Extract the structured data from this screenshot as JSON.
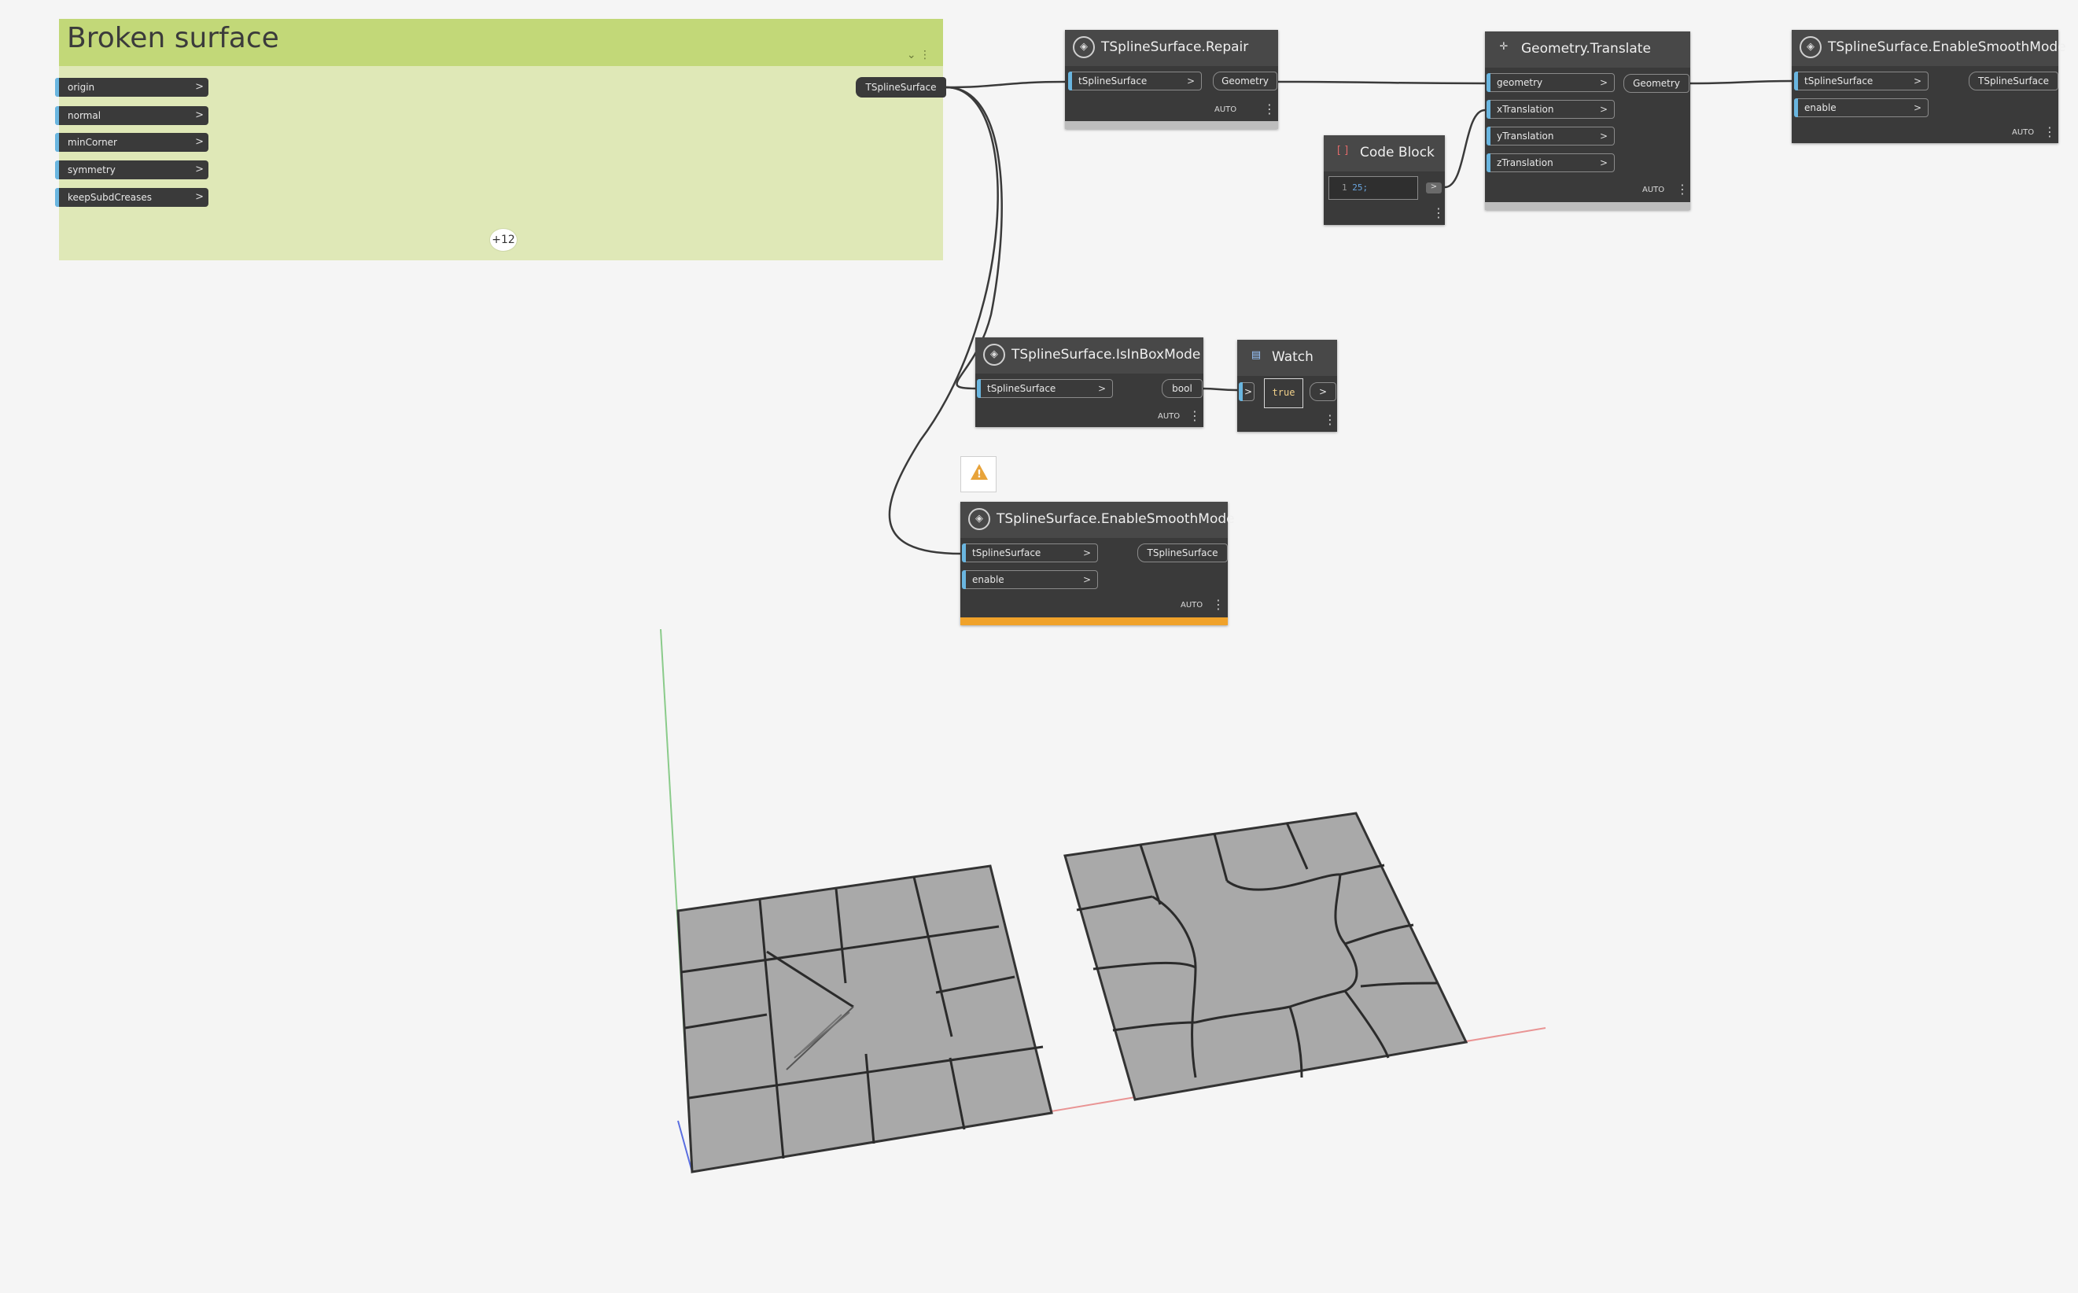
{
  "group": {
    "title": "Broken surface",
    "inputs": [
      "origin",
      "normal",
      "minCorner",
      "symmetry",
      "keepSubdCreases"
    ],
    "more_count": "+12",
    "output": "TSplineSurface"
  },
  "nodes": {
    "repair": {
      "title": "TSplineSurface.Repair",
      "input": "tSplineSurface",
      "output": "Geometry",
      "lacing": "AUTO"
    },
    "translate": {
      "title": "Geometry.Translate",
      "inputs": [
        "geometry",
        "xTranslation",
        "yTranslation",
        "zTranslation"
      ],
      "output": "Geometry",
      "lacing": "AUTO"
    },
    "smooth_top": {
      "title": "TSplineSurface.EnableSmoothMode",
      "inputs": [
        "tSplineSurface",
        "enable"
      ],
      "output": "TSplineSurface",
      "lacing": "AUTO"
    },
    "codeblock": {
      "title": "Code Block",
      "line_number": "1",
      "code": "25;"
    },
    "isinbox": {
      "title": "TSplineSurface.IsInBoxMode",
      "input": "tSplineSurface",
      "output": "bool",
      "lacing": "AUTO"
    },
    "watch": {
      "title": "Watch",
      "value": "true"
    },
    "smooth_bottom": {
      "title": "TSplineSurface.EnableSmoothMode",
      "inputs": [
        "tSplineSurface",
        "enable"
      ],
      "output": "TSplineSurface",
      "lacing": "AUTO"
    }
  },
  "colors": {
    "canvas": "#f5f5f5",
    "group_header": "#c2d878",
    "group_body": "#dfe8b7",
    "node_body": "#3a3a3a",
    "port_accent": "#6ab6e0",
    "warning": "#f0a22a",
    "surface_fill": "#a9a9a9",
    "axis_x": "#e88a8a",
    "axis_y": "#7fc77f",
    "axis_z": "#5a6ee0"
  },
  "icons": [
    "node-icon",
    "translate-icon",
    "code-block-icon",
    "watch-icon",
    "warning-icon",
    "more-options-icon",
    "collapse-icon"
  ]
}
